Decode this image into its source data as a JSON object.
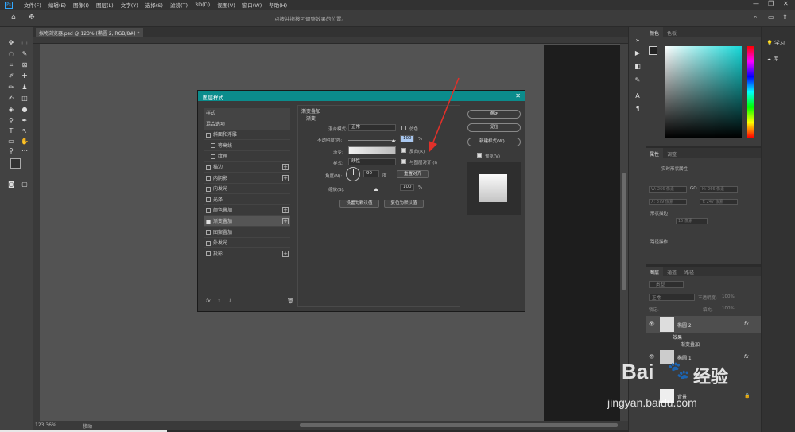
{
  "menu": {
    "items": [
      "文件(F)",
      "编辑(E)",
      "图像(I)",
      "图层(L)",
      "文字(Y)",
      "选择(S)",
      "滤镜(T)",
      "3D(D)",
      "视图(V)",
      "窗口(W)",
      "帮助(H)"
    ]
  },
  "options_bar": {
    "hint": "点按并拖移可调整效果的位置。"
  },
  "document": {
    "tab": "拟物浏览器.psd @ 123% (椭圆 2, RGB/8#) *",
    "zoom": "123.36%",
    "status": "移动"
  },
  "dialog": {
    "title": "图层样式",
    "styles": [
      {
        "label": "样式",
        "type": "header"
      },
      {
        "label": "混合选项",
        "type": "header"
      },
      {
        "label": "斜面和浮雕",
        "checked": false
      },
      {
        "label": "等高线",
        "checked": false,
        "indent": true
      },
      {
        "label": "纹理",
        "checked": false,
        "indent": true
      },
      {
        "label": "描边",
        "checked": false,
        "plus": true
      },
      {
        "label": "内阴影",
        "checked": false,
        "plus": true
      },
      {
        "label": "内发光",
        "checked": false
      },
      {
        "label": "光泽",
        "checked": false
      },
      {
        "label": "颜色叠加",
        "checked": false,
        "plus": true
      },
      {
        "label": "渐变叠加",
        "checked": true,
        "plus": true,
        "selected": true
      },
      {
        "label": "图案叠加",
        "checked": false
      },
      {
        "label": "外发光",
        "checked": false
      },
      {
        "label": "投影",
        "checked": false,
        "plus": true
      }
    ],
    "footer_icons": "fx",
    "section_title": "渐变叠加",
    "subsection": "渐变",
    "blend_mode_label": "混合模式:",
    "blend_mode": "正常",
    "dither_label": "仿色",
    "opacity_label": "不透明度(P):",
    "opacity": "100",
    "percent": "%",
    "gradient_label": "渐变:",
    "reverse_label": "反向(R)",
    "style_label": "样式:",
    "style": "线性",
    "align_label": "与图层对齐 (I)",
    "angle_label": "角度(N):",
    "angle": "90",
    "degree": "度",
    "reset_align": "重置对齐",
    "scale_label": "缩放(S):",
    "scale": "100",
    "make_default": "设置为默认值",
    "reset_default": "复位为默认值",
    "ok": "确定",
    "reset": "复位",
    "new_style": "新建样式(W)...",
    "preview_label": "预览(V)"
  },
  "color_panel": {
    "tabs": [
      "颜色",
      "色板"
    ]
  },
  "properties": {
    "tabs": [
      "属性",
      "调整"
    ],
    "header": "实时形状属性",
    "w": "W: 266 像素",
    "h": "H: 266 像素",
    "go": "GO",
    "x": "X: 379 像素",
    "y": "Y: 247 像素",
    "fill_stroke": "形状描边",
    "stroke_w": "15 像素",
    "path_ops": "路径操作"
  },
  "layers": {
    "tabs": [
      "图层",
      "通道",
      "路径"
    ],
    "filter": "类型",
    "mode": "正常",
    "opacity_label": "不透明度:",
    "opacity": "100%",
    "lock_label": "锁定:",
    "fill_label": "填充:",
    "fill": "100%",
    "rows": [
      {
        "name": "椭圆 2",
        "fx": "fx"
      },
      {
        "name": "效果"
      },
      {
        "name": "渐变叠加"
      },
      {
        "name": "椭圆 1",
        "fx": "fx"
      },
      {
        "name": "背景"
      }
    ]
  },
  "learn": {
    "items": [
      "学习",
      "库"
    ]
  },
  "watermark": {
    "brand": "Bai",
    "brand2": "经验",
    "url": "jingyan.baidu.com"
  }
}
